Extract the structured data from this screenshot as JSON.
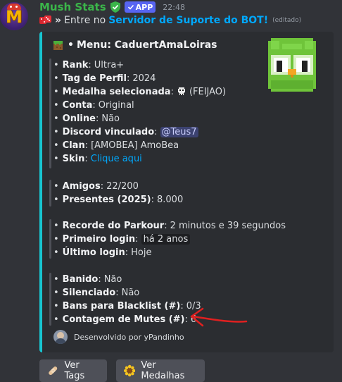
{
  "message": {
    "username": "Mush Stats",
    "app_tag": "APP",
    "timestamp": "22:48",
    "line_prefix": "»",
    "line_text": "Entre no",
    "line_link": "Servidor de Suporte do BOT!",
    "edited": "(editado)"
  },
  "embed": {
    "accent_color": "#17c5d1",
    "title_bullet": "•",
    "title": "Menu: CaduertAmaLoiras",
    "fields": [
      {
        "label": "Rank",
        "value": "Ultra+"
      },
      {
        "label": "Tag de Perfil",
        "value": "2024"
      },
      {
        "label": "Medalha selecionada",
        "value": "(FEIJAO)"
      },
      {
        "label": "Conta",
        "value": "Original"
      },
      {
        "label": "Online",
        "value": "Não"
      },
      {
        "label": "Discord vinculado",
        "value": "@Teus7"
      },
      {
        "label": "Clan",
        "value": "[AMOBEA] AmoBea"
      },
      {
        "label": "Skin",
        "value": "Clique aqui"
      },
      {
        "label": "Amigos",
        "value": "22/200"
      },
      {
        "label": "Presentes (2025)",
        "value": "8.000"
      },
      {
        "label": "Recorde do Parkour",
        "value": "2 minutos e 39 segundos"
      },
      {
        "label": "Primeiro login",
        "value": "há 2 anos"
      },
      {
        "label": "Último login",
        "value": "Hoje"
      },
      {
        "label": "Banido",
        "value": "Não"
      },
      {
        "label": "Silenciado",
        "value": "Não"
      },
      {
        "label": "Bans para Blacklist (#)",
        "value": "0/3"
      },
      {
        "label": "Contagem de Mutes (#)",
        "value": "6"
      }
    ],
    "bullet": "•",
    "colon": ":",
    "footer": "Desenvolvido por yPandinho"
  },
  "buttons": [
    {
      "label": "Ver Tags",
      "icon": "bandage-icon"
    },
    {
      "label": "Ver Medalhas",
      "icon": "sunflower-icon"
    }
  ],
  "colors": {
    "username": "#3bb54a",
    "link": "#00a8fc",
    "app_tag": "#5865f2",
    "annotation": "#e02020"
  }
}
